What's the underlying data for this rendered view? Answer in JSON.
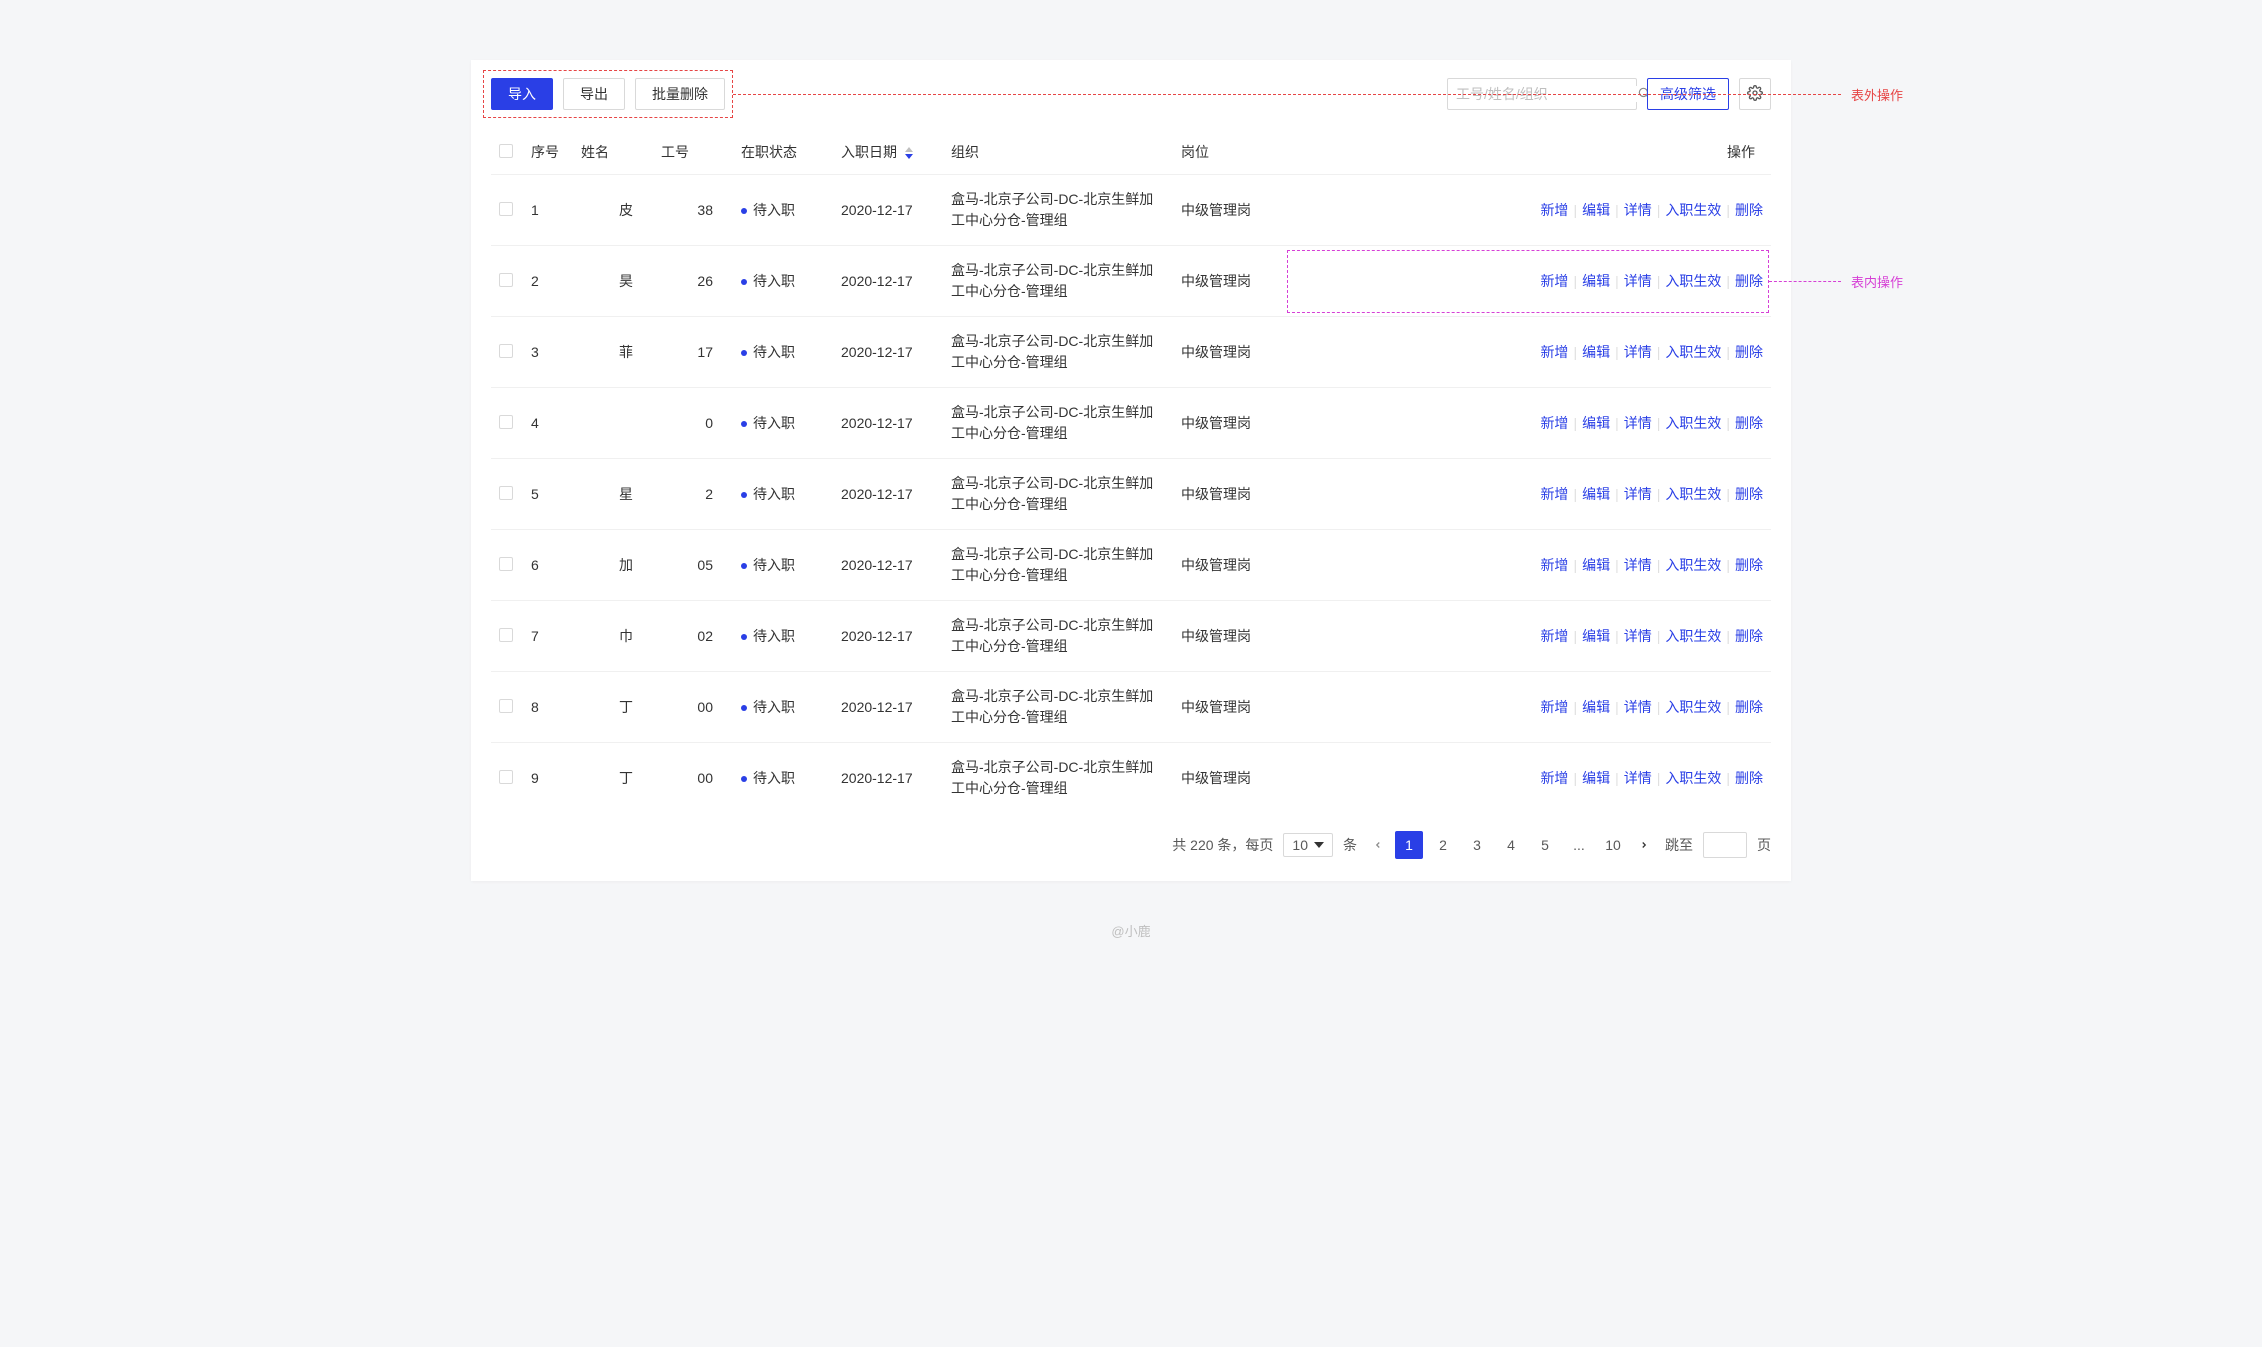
{
  "toolbar": {
    "import_label": "导入",
    "export_label": "导出",
    "batch_delete_label": "批量删除",
    "search_placeholder": "工号/姓名/组织",
    "filter_label": "高级筛选"
  },
  "annotations": {
    "outer_label": "表外操作",
    "inner_label": "表内操作"
  },
  "headers": {
    "seq": "序号",
    "name": "姓名",
    "emp_id": "工号",
    "status": "在职状态",
    "hire_date": "入职日期",
    "org": "组织",
    "position": "岗位",
    "actions": "操作"
  },
  "row_actions": {
    "add": "新增",
    "edit": "编辑",
    "detail": "详情",
    "effect": "入职生效",
    "delete": "删除"
  },
  "rows": [
    {
      "seq": "1",
      "name": "皮",
      "emp_id": "38",
      "status": "待入职",
      "hire_date": "2020-12-17",
      "org": "盒马-北京子公司-DC-北京生鲜加工中心分仓-管理组",
      "position": "中级管理岗"
    },
    {
      "seq": "2",
      "name": "昊",
      "emp_id": "26",
      "status": "待入职",
      "hire_date": "2020-12-17",
      "org": "盒马-北京子公司-DC-北京生鲜加工中心分仓-管理组",
      "position": "中级管理岗"
    },
    {
      "seq": "3",
      "name": "菲",
      "emp_id": "17",
      "status": "待入职",
      "hire_date": "2020-12-17",
      "org": "盒马-北京子公司-DC-北京生鲜加工中心分仓-管理组",
      "position": "中级管理岗"
    },
    {
      "seq": "4",
      "name": "",
      "emp_id": "0",
      "status": "待入职",
      "hire_date": "2020-12-17",
      "org": "盒马-北京子公司-DC-北京生鲜加工中心分仓-管理组",
      "position": "中级管理岗"
    },
    {
      "seq": "5",
      "name": "星",
      "emp_id": "2",
      "status": "待入职",
      "hire_date": "2020-12-17",
      "org": "盒马-北京子公司-DC-北京生鲜加工中心分仓-管理组",
      "position": "中级管理岗"
    },
    {
      "seq": "6",
      "name": "加",
      "emp_id": "05",
      "status": "待入职",
      "hire_date": "2020-12-17",
      "org": "盒马-北京子公司-DC-北京生鲜加工中心分仓-管理组",
      "position": "中级管理岗"
    },
    {
      "seq": "7",
      "name": "巾",
      "emp_id": "02",
      "status": "待入职",
      "hire_date": "2020-12-17",
      "org": "盒马-北京子公司-DC-北京生鲜加工中心分仓-管理组",
      "position": "中级管理岗"
    },
    {
      "seq": "8",
      "name": "丁",
      "emp_id": "00",
      "status": "待入职",
      "hire_date": "2020-12-17",
      "org": "盒马-北京子公司-DC-北京生鲜加工中心分仓-管理组",
      "position": "中级管理岗"
    },
    {
      "seq": "9",
      "name": "丁",
      "emp_id": "00",
      "status": "待入职",
      "hire_date": "2020-12-17",
      "org": "盒马-北京子公司-DC-北京生鲜加工中心分仓-管理组",
      "position": "中级管理岗"
    }
  ],
  "pagination": {
    "total_prefix": "共",
    "total_count": "220",
    "total_suffix": "条，每页",
    "page_size": "10",
    "unit": "条",
    "pages": [
      "1",
      "2",
      "3",
      "4",
      "5",
      "...",
      "10"
    ],
    "active_page": 0,
    "jump_label": "跳至",
    "jump_unit": "页"
  },
  "footer": "@小鹿"
}
